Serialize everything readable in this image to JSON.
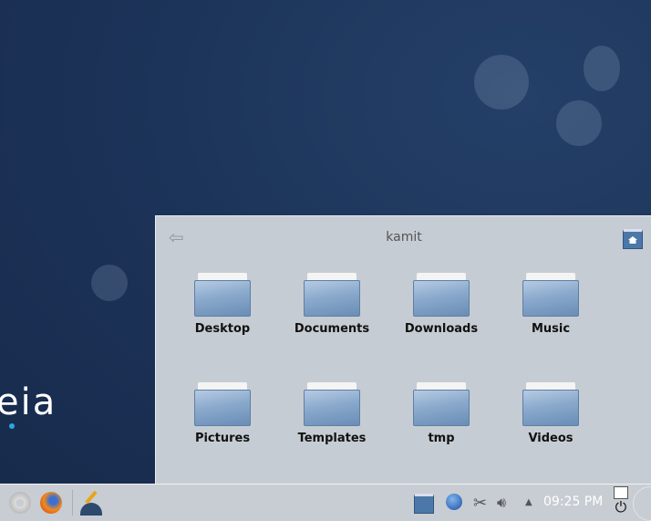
{
  "desktop": {
    "logo_text": "eia"
  },
  "folderview": {
    "title": "kamit",
    "back_icon": "back-arrow-icon",
    "home_icon": "home-folder-icon",
    "items": [
      {
        "label": "Desktop"
      },
      {
        "label": "Documents"
      },
      {
        "label": "Downloads"
      },
      {
        "label": "Music"
      },
      {
        "label": "Pictures"
      },
      {
        "label": "Templates"
      },
      {
        "label": "tmp"
      },
      {
        "label": "Videos"
      }
    ]
  },
  "panel": {
    "launchers": [
      "settings-icon",
      "firefox-icon",
      "system-tool-icon"
    ],
    "tray": [
      "home-folder-icon",
      "network-globe-icon",
      "klipper-scissors-icon",
      "volume-icon",
      "expand-tray-arrow-icon"
    ],
    "clock": "09:25 PM"
  }
}
